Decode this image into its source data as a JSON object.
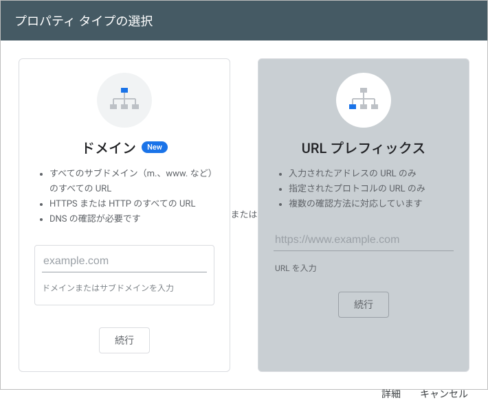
{
  "header": {
    "title": "プロパティ タイプの選択"
  },
  "separator_label": "または",
  "left_card": {
    "title": "ドメイン",
    "badge": "New",
    "bullets": [
      "すべてのサブドメイン（m.、www. など）のすべての URL",
      "HTTPS または HTTP のすべての URL",
      "DNS の確認が必要です"
    ],
    "input_placeholder": "example.com",
    "helper": "ドメインまたはサブドメインを入力",
    "continue": "続行"
  },
  "right_card": {
    "title": "URL プレフィックス",
    "bullets": [
      "入力されたアドレスの URL のみ",
      "指定されたプロトコルの URL のみ",
      "複数の確認方法に対応しています"
    ],
    "input_placeholder": "https://www.example.com",
    "helper": "URL を入力",
    "continue": "続行"
  },
  "footer": {
    "details": "詳細",
    "cancel": "キャンセル"
  }
}
